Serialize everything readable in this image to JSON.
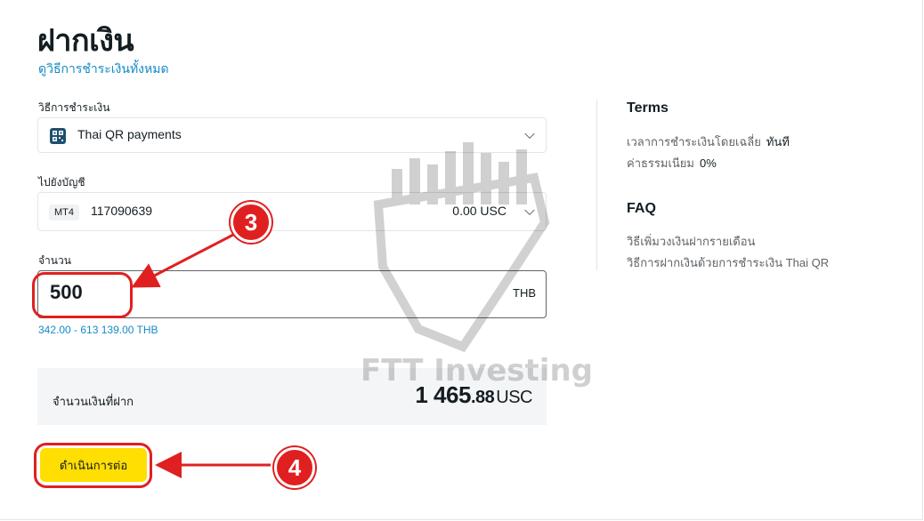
{
  "page": {
    "title": "ฝากเงิน",
    "all_methods_link": "ดูวิธีการชำระเงินทั้งหมด"
  },
  "form": {
    "payment_method": {
      "label": "วิธีการชำระเงิน",
      "value": "Thai QR payments",
      "icon": "qr-code-icon"
    },
    "account": {
      "label": "ไปยังบัญชี",
      "badge": "MT4",
      "number": "117090639",
      "balance": "0.00 USC"
    },
    "amount": {
      "label": "จำนวน",
      "value": "500",
      "currency": "THB",
      "range": "342.00 - 613 139.00 THB"
    },
    "summary": {
      "label": "จำนวนเงินที่ฝาก",
      "amount_int": "1 465",
      "amount_dec": ".88",
      "currency": "USC"
    },
    "continue_label": "ดำเนินการต่อ"
  },
  "sidebar": {
    "terms_title": "Terms",
    "terms": [
      {
        "label": "เวลาการชำระเงินโดยเฉลี่ย",
        "value": "ทันที"
      },
      {
        "label": "ค่าธรรมเนียม",
        "value": "0%"
      }
    ],
    "faq_title": "FAQ",
    "faq": [
      "วิธีเพิ่มวงเงินฝากรายเดือน",
      "วิธีการฝากเงินด้วยการชำระเงิน Thai QR"
    ]
  },
  "annotations": {
    "step_3": "3",
    "step_4": "4",
    "color": "#e02020"
  },
  "watermark": "FTT Investing",
  "colors": {
    "accent_link": "#158bc6",
    "button": "#ffde02",
    "summary_bg": "#f3f5f7"
  }
}
